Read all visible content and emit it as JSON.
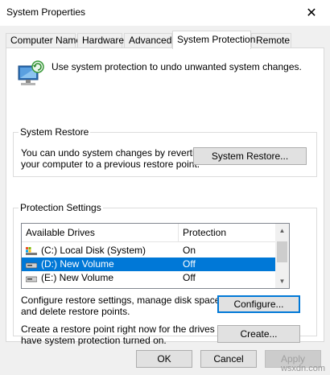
{
  "window": {
    "title": "System Properties",
    "close_glyph": "✕"
  },
  "tabs": [
    {
      "label": "Computer Name"
    },
    {
      "label": "Hardware"
    },
    {
      "label": "Advanced"
    },
    {
      "label": "System Protection",
      "active": true
    },
    {
      "label": "Remote"
    }
  ],
  "intro": "Use system protection to undo unwanted system changes.",
  "system_restore": {
    "title": "System Restore",
    "text_line1": "You can undo system changes by reverting",
    "text_line2": "your computer to a previous restore point.",
    "button": "System Restore..."
  },
  "protection": {
    "title": "Protection Settings",
    "columns": [
      "Available Drives",
      "Protection"
    ],
    "drives": [
      {
        "name": "(C:) Local Disk (System)",
        "protection": "On",
        "icon": "system-drive-icon"
      },
      {
        "name": "(D:) New Volume",
        "protection": "Off",
        "icon": "drive-icon",
        "selected": true
      },
      {
        "name": "(E:) New Volume",
        "protection": "Off",
        "icon": "drive-icon"
      }
    ],
    "configure_line1": "Configure restore settings, manage disk space,",
    "configure_line2": "and delete restore points.",
    "configure_button": "Configure...",
    "create_line1": "Create a restore point right now for the drives that",
    "create_line2": "have system protection turned on.",
    "create_button": "Create..."
  },
  "footer": {
    "ok": "OK",
    "cancel": "Cancel",
    "apply": "Apply"
  },
  "watermark": "wsxdn.com",
  "colors": {
    "selection": "#0078d7",
    "focus_border": "#0078d7",
    "dialog_bg": "#f0f0f0"
  }
}
